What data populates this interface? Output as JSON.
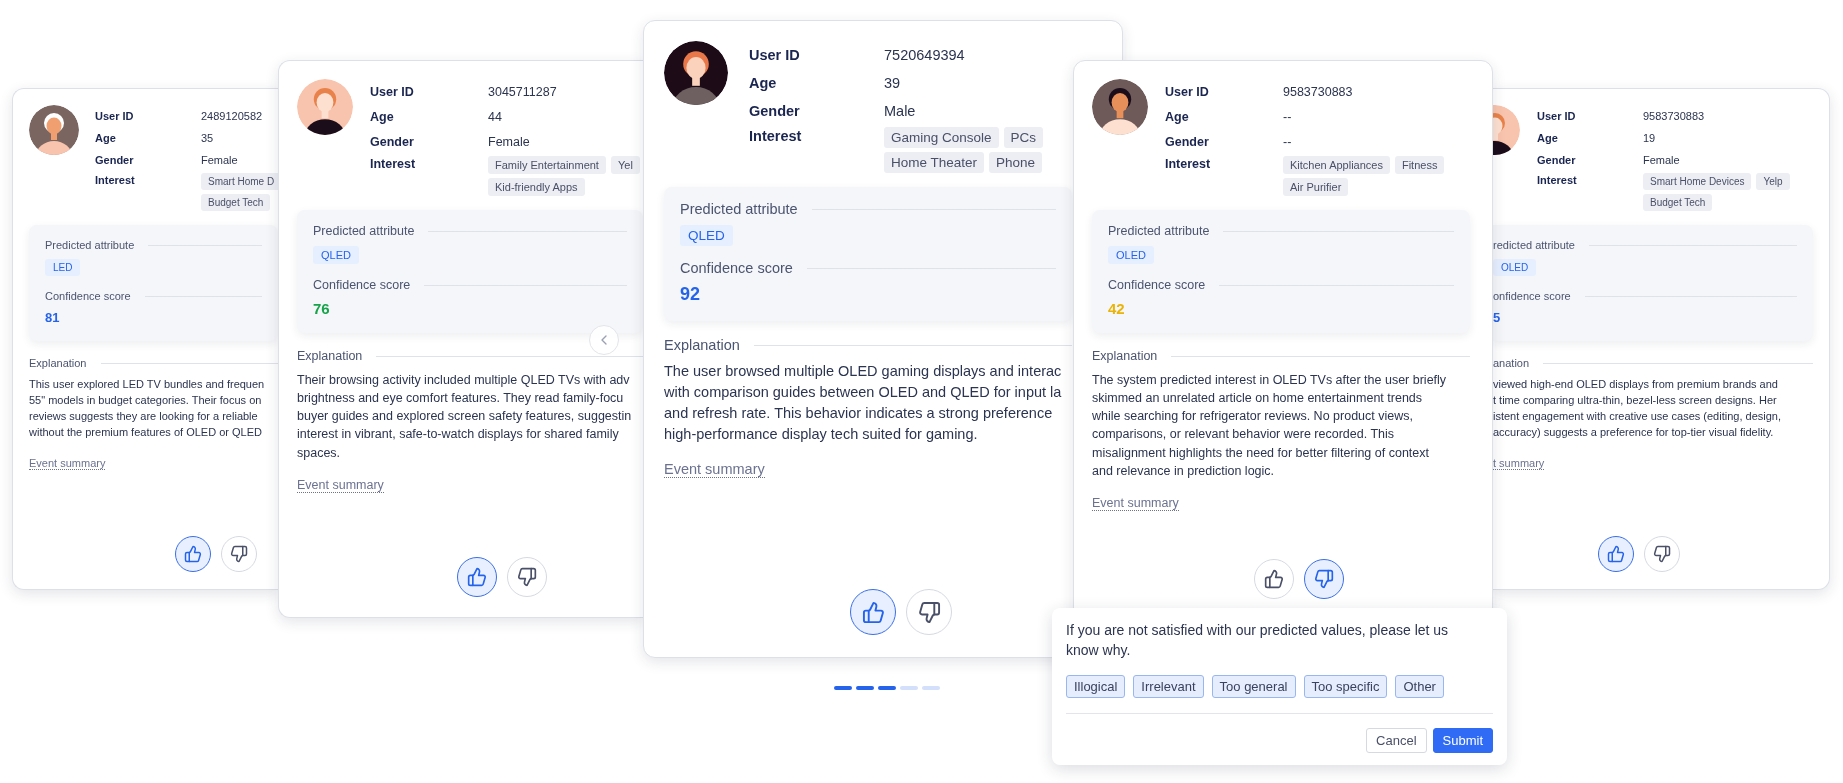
{
  "cards": [
    {
      "fields": [
        {
          "label": "User ID",
          "value": "2489120582"
        },
        {
          "label": "Age",
          "value": "35"
        },
        {
          "label": "Gender",
          "value": "Female"
        }
      ],
      "interest": {
        "label": "Interest",
        "tags": [
          "Smart Home D",
          "Budget Tech"
        ]
      },
      "predicted": {
        "label": "Predicted attribute",
        "value": "LED"
      },
      "confidence": {
        "label": "Confidence score",
        "value": "81",
        "color": "#2563eb"
      },
      "explanation": {
        "label": "Explanation",
        "lines": [
          "This user explored LED TV bundles and frequen",
          "55\" models in budget categories. Their focus on",
          "reviews suggests they are looking for a reliable",
          "without the premium features of OLED or QLED"
        ]
      },
      "event_summary": "Event summary",
      "thumbs_up": {
        "selected": true
      },
      "thumbs_down": {
        "selected": false
      }
    },
    {
      "fields": [
        {
          "label": "User ID",
          "value": "3045711287"
        },
        {
          "label": "Age",
          "value": "44"
        },
        {
          "label": "Gender",
          "value": "Female"
        }
      ],
      "interest": {
        "label": "Interest",
        "tags": [
          "Family Entertainment",
          "Yel",
          "Kid-friendly Apps"
        ]
      },
      "predicted": {
        "label": "Predicted attribute",
        "value": "QLED"
      },
      "confidence": {
        "label": "Confidence score",
        "value": "76",
        "color": "#16a34a"
      },
      "explanation": {
        "label": "Explanation",
        "lines": [
          "Their browsing activity included multiple QLED TVs with adv",
          "brightness and eye comfort features. They read family-focu",
          "buyer guides and explored screen safety features, suggestin",
          "interest in vibrant, safe-to-watch displays for shared family",
          "spaces."
        ]
      },
      "event_summary": "Event summary",
      "thumbs_up": {
        "selected": true
      },
      "thumbs_down": {
        "selected": false
      }
    },
    {
      "fields": [
        {
          "label": "User ID",
          "value": "7520649394"
        },
        {
          "label": "Age",
          "value": "39"
        },
        {
          "label": "Gender",
          "value": "Male"
        }
      ],
      "interest": {
        "label": "Interest",
        "tags": [
          "Gaming Console",
          "PCs",
          "Home Theater",
          "Phone"
        ]
      },
      "predicted": {
        "label": "Predicted attribute",
        "value": "QLED"
      },
      "confidence": {
        "label": "Confidence score",
        "value": "92",
        "color": "#2563eb"
      },
      "explanation": {
        "label": "Explanation",
        "lines": [
          "The user browsed multiple OLED gaming displays and interac",
          "with comparison guides between OLED and QLED for input la",
          "and refresh rate. This behavior indicates a strong preference",
          "high-performance display tech suited for gaming."
        ]
      },
      "event_summary": "Event summary",
      "thumbs_up": {
        "selected": true
      },
      "thumbs_down": {
        "selected": false
      }
    },
    {
      "fields": [
        {
          "label": "User ID",
          "value": "9583730883"
        },
        {
          "label": "Age",
          "value": "--"
        },
        {
          "label": "Gender",
          "value": "--"
        }
      ],
      "interest": {
        "label": "Interest",
        "tags": [
          "Kitchen Appliances",
          "Fitness",
          "Air Purifier"
        ]
      },
      "predicted": {
        "label": "Predicted attribute",
        "value": "OLED"
      },
      "confidence": {
        "label": "Confidence score",
        "value": "42",
        "color": "#eab308"
      },
      "explanation": {
        "label": "Explanation",
        "lines": [
          "The system predicted interest in OLED TVs after the user briefly",
          "skimmed an unrelated article on home entertainment trends",
          "while searching for refrigerator reviews. No product views,",
          "comparisons, or relevant behavior were recorded. This",
          "misalignment highlights the need for better filtering of context",
          "and relevance in prediction logic."
        ]
      },
      "event_summary": "Event summary",
      "thumbs_up": {
        "selected": false
      },
      "thumbs_down": {
        "selected": true
      }
    },
    {
      "fields": [
        {
          "label": "User ID",
          "value": "9583730883"
        },
        {
          "label": "Age",
          "value": "19"
        },
        {
          "label": "Gender",
          "value": "Female"
        }
      ],
      "interest": {
        "label": "Interest",
        "tags": [
          "Smart Home Devices",
          "Yelp",
          "Budget Tech"
        ]
      },
      "predicted": {
        "label": "redicted attribute",
        "value": "OLED"
      },
      "confidence": {
        "label": "onfidence score",
        "value": "5",
        "color": "#2563eb"
      },
      "explanation": {
        "label": "anation",
        "lines": [
          "viewed high-end OLED displays from premium brands and",
          "t time comparing ultra-thin, bezel-less screen designs. Her",
          "istent engagement with creative use cases (editing, design,",
          "accuracy) suggests a preference for top-tier visual fidelity."
        ]
      },
      "event_summary": "t summary",
      "thumbs_up": {
        "selected": true
      },
      "thumbs_down": {
        "selected": false
      }
    }
  ],
  "pagination": [
    {
      "selected": true
    },
    {
      "selected": true
    },
    {
      "selected": true
    },
    {
      "selected": false
    },
    {
      "selected": false
    }
  ],
  "feedback_popup": {
    "message": "If you are not satisfied with our predicted values, please let us know why.",
    "reasons": [
      "Illogical",
      "Irrelevant",
      "Too general",
      "Too specific",
      "Other"
    ],
    "cancel": "Cancel",
    "submit": "Submit"
  }
}
